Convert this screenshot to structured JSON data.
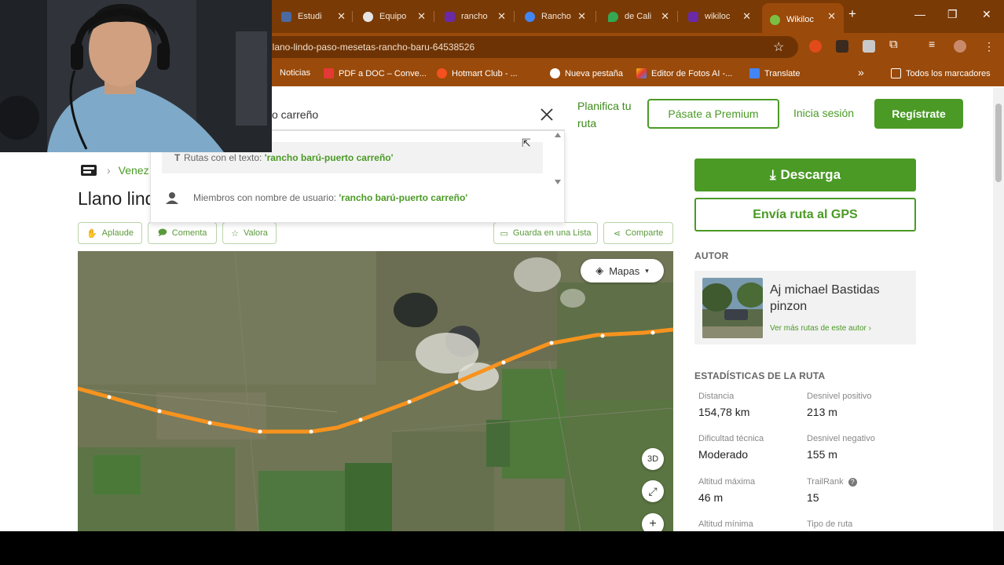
{
  "browser": {
    "tabs": [
      {
        "label": "Estudi",
        "color": "#4a6aa0"
      },
      {
        "label": "Equipo",
        "color": "#e5e5e5"
      },
      {
        "label": "rancho",
        "color": "#6a2aa8"
      },
      {
        "label": "Rancho",
        "color": "#4285f4"
      },
      {
        "label": "de Cali",
        "color": "#34a853"
      },
      {
        "label": "wikiloc",
        "color": "#6a2aa8"
      },
      {
        "label": "Wikiloc",
        "color": "#7ac143"
      }
    ],
    "url": "llano-lindo-paso-mesetas-rancho-baru-64538526",
    "bookmarks": [
      {
        "label": "Noticias",
        "color": "#e8e8e8"
      },
      {
        "label": "PDF a DOC – Conve...",
        "color": "#e53935"
      },
      {
        "label": "Hotmart Club - ...",
        "color": "#f4511e"
      },
      {
        "label": "Nueva pestaña",
        "color": "#ffffff"
      },
      {
        "label": "Editor de Fotos AI -...",
        "color": "#fbbc04"
      },
      {
        "label": "Translate",
        "color": "#4285f4"
      }
    ],
    "all_bookmarks": "Todos los marcadores",
    "bookmarks_overflow": "»"
  },
  "nav": {
    "plan_route": "Planifica tu ruta",
    "premium": "Pásate a Premium",
    "login": "Inicia sesión",
    "register": "Regístrate"
  },
  "search": {
    "value": "o carreño",
    "suggestion_text_prefix": "Rutas con el texto: ",
    "suggestion_text_query": "'rancho barú-puerto carreño'",
    "suggestion_user_prefix": "Miembros con nombre de usuario: ",
    "suggestion_user_query": "'rancho barú-puerto carreño'"
  },
  "route": {
    "breadcrumb": "Venez",
    "title": "Llano lind",
    "actions": {
      "applaud": "Aplaude",
      "comment": "Comenta",
      "rate": "Valora",
      "save": "Guarda en una Lista",
      "share": "Comparte"
    }
  },
  "map": {
    "layers_label": "Mapas",
    "btn_3d": "3D",
    "route_color": "#f7931e"
  },
  "sidebar": {
    "download": "Descarga",
    "send_gps": "Envía ruta al GPS",
    "author_heading": "AUTOR",
    "author_name": "Aj michael Bastidas pinzon",
    "author_more": "Ver más rutas de este autor ›",
    "stats_heading": "ESTADÍSTICAS DE LA RUTA",
    "stats": [
      {
        "label": "Distancia",
        "value": "154,78 km"
      },
      {
        "label": "Desnivel positivo",
        "value": "213 m"
      },
      {
        "label": "Dificultad técnica",
        "value": "Moderado"
      },
      {
        "label": "Desnivel negativo",
        "value": "155 m"
      },
      {
        "label": "Altitud máxima",
        "value": "46 m"
      },
      {
        "label": "TrailRank",
        "value": "15"
      },
      {
        "label": "Altitud mínima",
        "value": ""
      },
      {
        "label": "Tipo de ruta",
        "value": ""
      }
    ]
  },
  "colors": {
    "brand_green": "#4a9a25",
    "chrome_frame": "#9a4a0a"
  }
}
